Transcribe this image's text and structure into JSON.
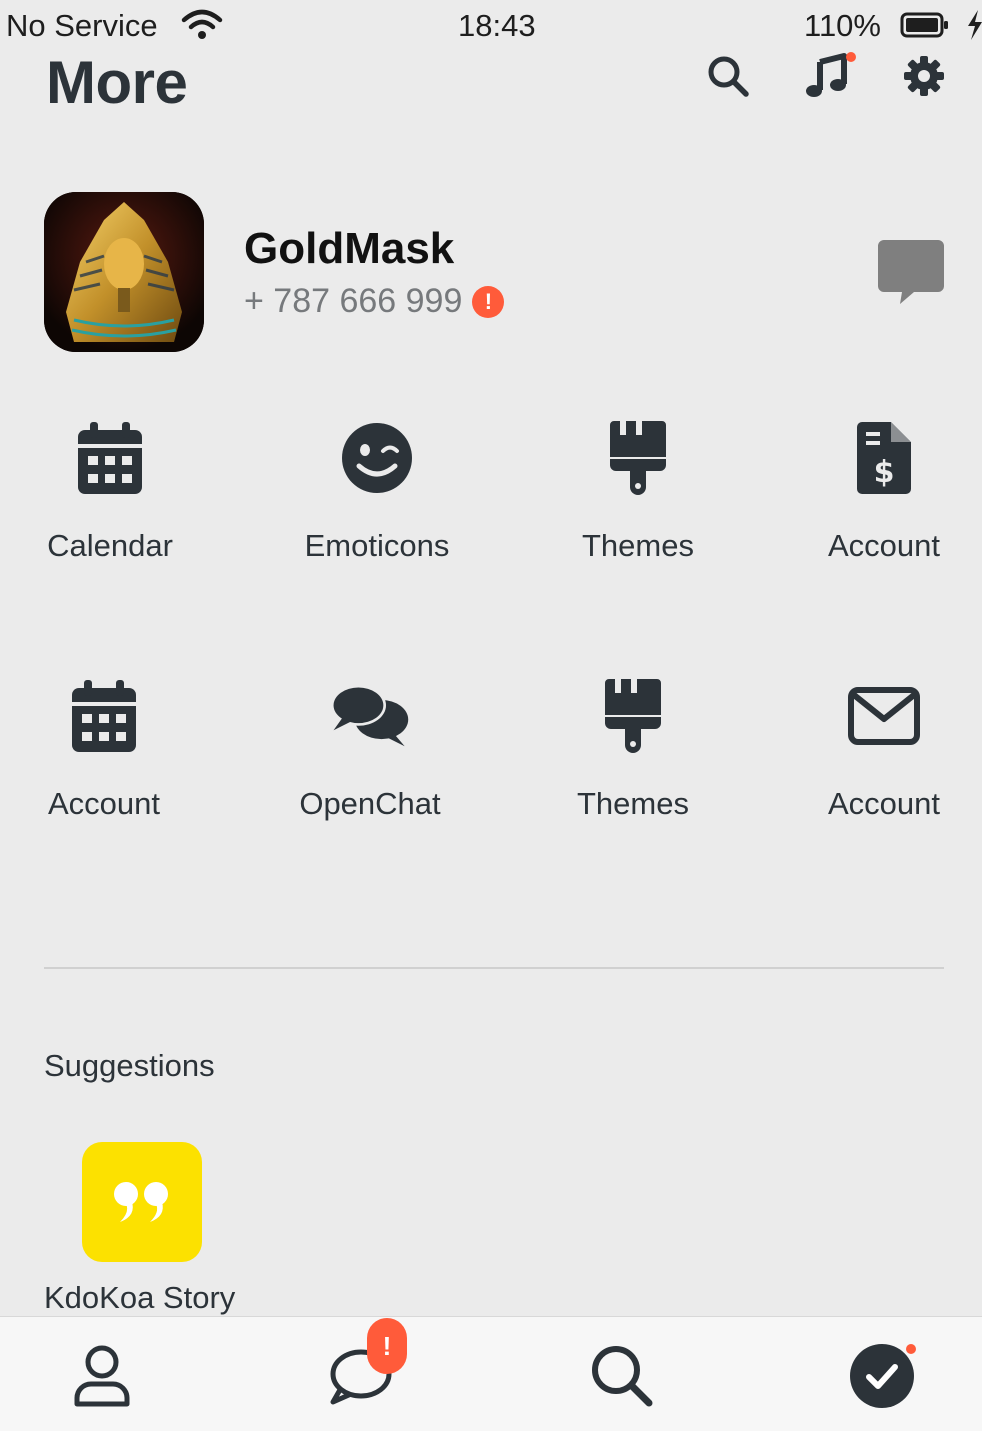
{
  "status_bar": {
    "carrier": "No Service",
    "time": "18:43",
    "battery": "110%"
  },
  "header": {
    "title": "More",
    "icons": [
      "search-icon",
      "music-note-icon",
      "gear-icon"
    ]
  },
  "profile": {
    "name": "GoldMask",
    "phone": "+ 787 666 999",
    "alert": "!"
  },
  "grid": {
    "items": [
      {
        "label": "Calendar",
        "icon": "calendar-icon"
      },
      {
        "label": "Emoticons",
        "icon": "wink-face-icon"
      },
      {
        "label": "Themes",
        "icon": "paint-brush-icon"
      },
      {
        "label": "Account",
        "icon": "invoice-dollar-icon"
      },
      {
        "label": "Account",
        "icon": "calendar-icon"
      },
      {
        "label": "OpenChat",
        "icon": "chat-bubbles-icon"
      },
      {
        "label": "Themes",
        "icon": "paint-brush-icon"
      },
      {
        "label": "Account",
        "icon": "envelope-icon"
      }
    ]
  },
  "suggestions": {
    "heading": "Suggestions",
    "items": [
      {
        "label": "KdoKoa Story",
        "icon": "quote-icon"
      }
    ]
  },
  "tab_bar": {
    "tabs": [
      "profile-icon",
      "chat-icon",
      "search-icon",
      "check-circle-icon"
    ],
    "chat_badge": "!"
  },
  "colors": {
    "background": "#ebebeb",
    "icon": "#2c3339",
    "accent_red": "#ff5b3a",
    "suggestion_yellow": "#fce100"
  }
}
